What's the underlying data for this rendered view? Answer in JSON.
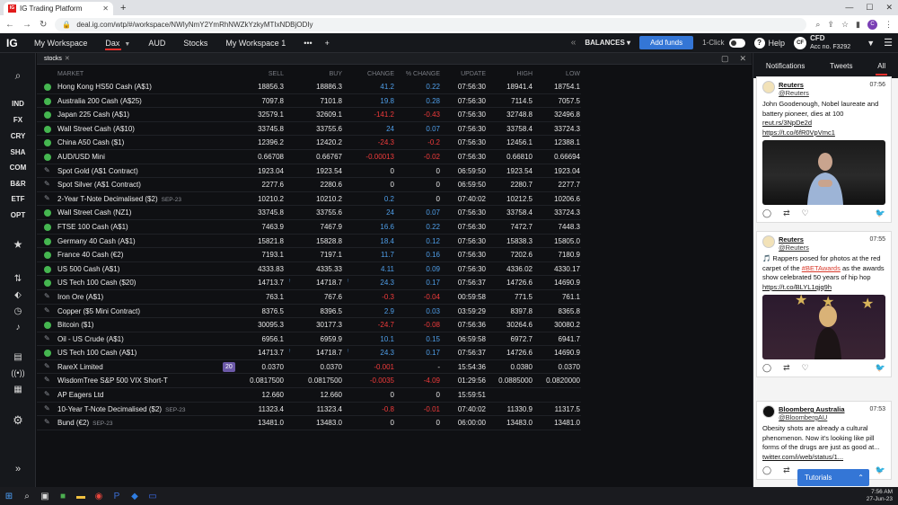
{
  "browser": {
    "tab_title": "IG Trading Platform",
    "tab_favicon": "IG",
    "url": "deal.ig.com/wtp/#/workspace/NWIyNmY2YmRhNWZkYzkyMTIxNDBjODIy",
    "profile_initial": "C"
  },
  "topbar": {
    "logo": "IG",
    "tabs": [
      {
        "label": "My Workspace"
      },
      {
        "label": "Dax",
        "active": true
      },
      {
        "label": "AUD"
      },
      {
        "label": "Stocks"
      },
      {
        "label": "My Workspace 1"
      }
    ],
    "more": "•••",
    "add": "+",
    "balances": "BALANCES",
    "add_funds": "Add funds",
    "one_click": "1-Click",
    "help": "Help",
    "account_initials": "CF",
    "account_type": "CFD",
    "account_no": "Acc no. F3292"
  },
  "sidebar": {
    "codes": [
      "IND",
      "FX",
      "CRY",
      "SHA",
      "COM",
      "B&R",
      "ETF",
      "OPT"
    ]
  },
  "workspace": {
    "tab": "stocks"
  },
  "table": {
    "headers": {
      "market": "MARKET",
      "sell": "SELL",
      "buy": "BUY",
      "change": "CHANGE",
      "pct": "% CHANGE",
      "update": "UPDATE",
      "high": "HIGH",
      "low": "LOW"
    },
    "rows": [
      {
        "ind": "dot",
        "name": "Hong Kong HS50 Cash (A$1)",
        "sell": "18856.3",
        "buy": "18886.3",
        "change": "41.2",
        "pct": "0.22",
        "update": "07:56:30",
        "high": "18941.4",
        "low": "18754.1",
        "dir": "up"
      },
      {
        "ind": "dot",
        "name": "Australia 200 Cash (A$25)",
        "sell": "7097.8",
        "buy": "7101.8",
        "change": "19.8",
        "pct": "0.28",
        "update": "07:56:30",
        "high": "7114.5",
        "low": "7057.5",
        "dir": "up"
      },
      {
        "ind": "dot",
        "name": "Japan 225 Cash (A$1)",
        "sell": "32579.1",
        "buy": "32609.1",
        "change": "-141.2",
        "pct": "-0.43",
        "update": "07:56:30",
        "high": "32748.8",
        "low": "32496.8",
        "dir": "down"
      },
      {
        "ind": "dot",
        "name": "Wall Street Cash (A$10)",
        "sell": "33745.8",
        "buy": "33755.6",
        "change": "24",
        "pct": "0.07",
        "update": "07:56:30",
        "high": "33758.4",
        "low": "33724.3",
        "dir": "up"
      },
      {
        "ind": "dot",
        "name": "China A50 Cash ($1)",
        "sell": "12396.2",
        "buy": "12420.2",
        "change": "-24.3",
        "pct": "-0.2",
        "update": "07:56:30",
        "high": "12456.1",
        "low": "12388.1",
        "dir": "down"
      },
      {
        "ind": "dot",
        "name": "AUD/USD Mini",
        "sell": "0.66708",
        "buy": "0.66767",
        "change": "-0.00013",
        "pct": "-0.02",
        "update": "07:56:30",
        "high": "0.66810",
        "low": "0.66694",
        "dir": "down"
      },
      {
        "ind": "pencil",
        "name": "Spot Gold (A$1 Contract)",
        "sell": "1923.04",
        "buy": "1923.54",
        "change": "0",
        "pct": "0",
        "update": "06:59:50",
        "high": "1923.54",
        "low": "1923.04",
        "dir": "neu"
      },
      {
        "ind": "pencil",
        "name": "Spot Silver (A$1 Contract)",
        "sell": "2277.6",
        "buy": "2280.6",
        "change": "0",
        "pct": "0",
        "update": "06:59:50",
        "high": "2280.7",
        "low": "2277.7",
        "dir": "neu"
      },
      {
        "ind": "pencil",
        "name": "2-Year T-Note Decimalised ($2)",
        "sub": "SEP-23",
        "sell": "10210.2",
        "buy": "10210.2",
        "change": "0.2",
        "pct": "0",
        "update": "07:40:02",
        "high": "10212.5",
        "low": "10206.6",
        "dir": "up",
        "pctdir": "neu"
      },
      {
        "ind": "dot",
        "name": "Wall Street Cash (NZ1)",
        "sell": "33745.8",
        "buy": "33755.6",
        "change": "24",
        "pct": "0.07",
        "update": "07:56:30",
        "high": "33758.4",
        "low": "33724.3",
        "dir": "up"
      },
      {
        "ind": "dot",
        "name": "FTSE 100 Cash (A$1)",
        "sell": "7463.9",
        "buy": "7467.9",
        "change": "16.6",
        "pct": "0.22",
        "update": "07:56:30",
        "high": "7472.7",
        "low": "7448.3",
        "dir": "up"
      },
      {
        "ind": "dot",
        "name": "Germany 40 Cash (A$1)",
        "sell": "15821.8",
        "buy": "15828.8",
        "change": "18.4",
        "pct": "0.12",
        "update": "07:56:30",
        "high": "15838.3",
        "low": "15805.0",
        "dir": "up"
      },
      {
        "ind": "dot",
        "name": "France 40 Cash (€2)",
        "sell": "7193.1",
        "buy": "7197.1",
        "change": "11.7",
        "pct": "0.16",
        "update": "07:56:30",
        "high": "7202.6",
        "low": "7180.9",
        "dir": "up"
      },
      {
        "ind": "dot",
        "name": "US 500 Cash (A$1)",
        "sell": "4333.83",
        "buy": "4335.33",
        "change": "4.11",
        "pct": "0.09",
        "update": "07:56:30",
        "high": "4336.02",
        "low": "4330.17",
        "dir": "up"
      },
      {
        "ind": "dot",
        "name": "US Tech 100 Cash ($20)",
        "sell": "14713.7",
        "sell_tick": "↑",
        "buy": "14718.7",
        "buy_tick": "↑",
        "change": "24.3",
        "pct": "0.17",
        "update": "07:56:37",
        "high": "14726.6",
        "low": "14690.9",
        "dir": "up"
      },
      {
        "ind": "pencil",
        "name": "Iron Ore (A$1)",
        "sell": "763.1",
        "buy": "767.6",
        "change": "-0.3",
        "pct": "-0.04",
        "update": "00:59:58",
        "high": "771.5",
        "low": "761.1",
        "dir": "down"
      },
      {
        "ind": "pencil",
        "name": "Copper ($5 Mini Contract)",
        "sell": "8376.5",
        "buy": "8396.5",
        "change": "2.9",
        "pct": "0.03",
        "update": "03:59:29",
        "high": "8397.8",
        "low": "8365.8",
        "dir": "up"
      },
      {
        "ind": "dot",
        "name": "Bitcoin ($1)",
        "sell": "30095.3",
        "buy": "30177.3",
        "change": "-24.7",
        "pct": "-0.08",
        "update": "07:56:36",
        "high": "30264.6",
        "low": "30080.2",
        "dir": "down"
      },
      {
        "ind": "pencil",
        "name": "Oil - US Crude (A$1)",
        "sell": "6956.1",
        "buy": "6959.9",
        "change": "10.1",
        "pct": "0.15",
        "update": "06:59:58",
        "high": "6972.7",
        "low": "6941.7",
        "dir": "up"
      },
      {
        "ind": "dot",
        "name": "US Tech 100 Cash (A$1)",
        "sell": "14713.7",
        "sell_tick": "↑",
        "buy": "14718.7",
        "buy_tick": "↑",
        "change": "24.3",
        "pct": "0.17",
        "update": "07:56:37",
        "high": "14726.6",
        "low": "14690.9",
        "dir": "up"
      },
      {
        "ind": "pencil",
        "name": "RareX Limited",
        "badge": "20",
        "sell": "0.0370",
        "buy": "0.0370",
        "change": "-0.001",
        "pct": "-",
        "update": "15:54:36",
        "high": "0.0380",
        "low": "0.0370",
        "dir": "down",
        "pctdir": "neu"
      },
      {
        "ind": "pencil",
        "name": "WisdomTree S&P 500 VIX Short-T",
        "sell": "0.0817500",
        "buy": "0.0817500",
        "change": "-0.0035",
        "pct": "-4.09",
        "update": "01:29:56",
        "high": "0.0885000",
        "low": "0.0820000",
        "dir": "down"
      },
      {
        "ind": "pencil",
        "name": "AP Eagers Ltd",
        "sell": "12.660",
        "buy": "12.660",
        "change": "0",
        "pct": "0",
        "update": "15:59:51",
        "high": "",
        "low": "",
        "dir": "neu"
      },
      {
        "ind": "pencil",
        "name": "10-Year T-Note Decimalised ($2)",
        "sub": "SEP-23",
        "sell": "11323.4",
        "buy": "11323.4",
        "change": "-0.8",
        "pct": "-0.01",
        "update": "07:40:02",
        "high": "11330.9",
        "low": "11317.5",
        "dir": "down"
      },
      {
        "ind": "pencil",
        "name": "Bund (€2)",
        "sub": "SEP-23",
        "sell": "13481.0",
        "buy": "13483.0",
        "change": "0",
        "pct": "0",
        "update": "06:00:00",
        "high": "13483.0",
        "low": "13481.0",
        "dir": "neu"
      }
    ]
  },
  "feed": {
    "tabs": [
      "Notifications",
      "Tweets",
      "All"
    ],
    "active": "All",
    "tweets": [
      {
        "name": "Reuters",
        "handle": "@Reuters",
        "time": "07:56",
        "text": "John Goodenough, Nobel laureate and battery pioneer, dies at 100",
        "links": [
          "reut.rs/3NpDe2d",
          "https://t.co/6fR0VpVmc1"
        ]
      },
      {
        "name": "Reuters",
        "handle": "@Reuters",
        "time": "07:55",
        "text_pre": "🎵 Rappers posed for photos at the red carpet of the ",
        "hashtag": "#BETAwards",
        "text_post": " as the awards show celebrated 50 years of hip hop",
        "links": [
          "https://t.co/BLYL1qjq9h"
        ]
      },
      {
        "name": "Bloomberg Australia",
        "handle": "@BloombergAU",
        "time": "07:53",
        "text": "Obesity shots are already a cultural phenomenon. Now it's looking like pill forms of the drugs are just as good at...",
        "links": [
          "twitter.com/i/web/status/1..."
        ]
      }
    ]
  },
  "tutorials": "Tutorials",
  "taskbar": {
    "time": "7:56 AM",
    "date": "27-Jun-23"
  }
}
